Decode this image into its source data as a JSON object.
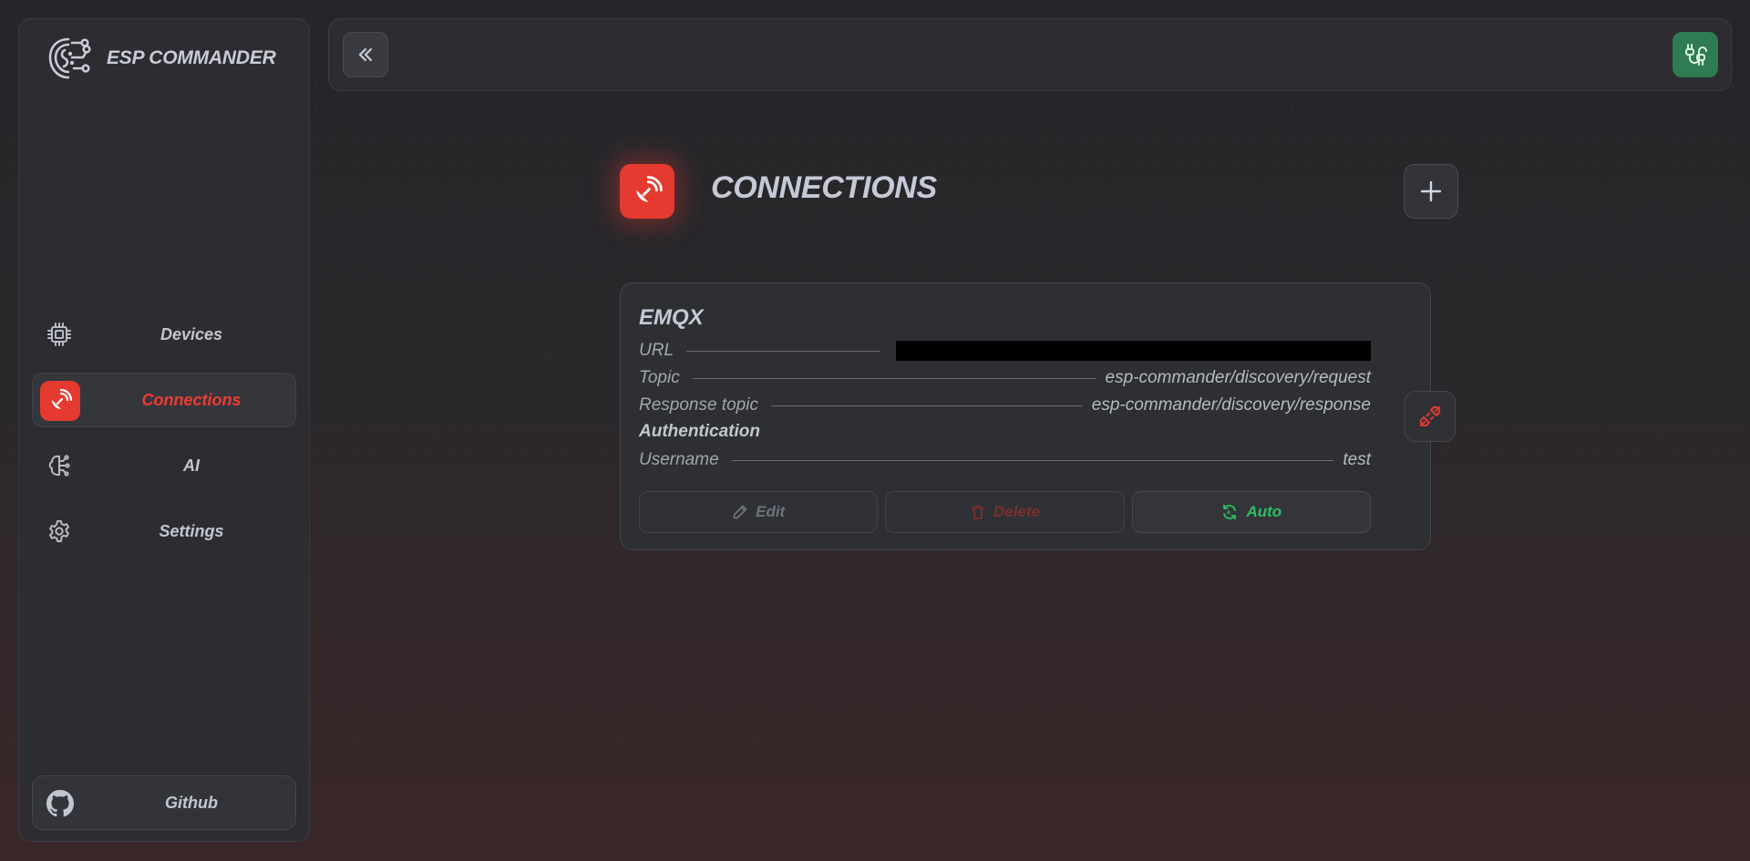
{
  "brand": {
    "name": "ESP COMMANDER",
    "logo_icon": "circuit-brain-logo"
  },
  "sidebar": {
    "items": [
      {
        "label": "Devices",
        "icon": "chip-icon",
        "active": false
      },
      {
        "label": "Connections",
        "icon": "satellite-dish-icon",
        "active": true
      },
      {
        "label": "AI",
        "icon": "brain-circuit-icon",
        "active": false
      },
      {
        "label": "Settings",
        "icon": "gear-icon",
        "active": false
      }
    ],
    "github_label": "Github"
  },
  "topbar": {
    "collapse_icon": "chevrons-left-icon",
    "status_icon": "plug-icon"
  },
  "page": {
    "title": "CONNECTIONS",
    "add_icon": "plus-icon"
  },
  "connection": {
    "name": "EMQX",
    "url_label": "URL",
    "url_value": "",
    "topic_label": "Topic",
    "topic_value": "esp-commander/discovery/request",
    "response_topic_label": "Response topic",
    "response_topic_value": "esp-commander/discovery/response",
    "auth_title": "Authentication",
    "username_label": "Username",
    "username_value": "test",
    "edit_label": "Edit",
    "delete_label": "Delete",
    "auto_label": "Auto"
  },
  "colors": {
    "accent_red": "#e53a2f",
    "success_green": "#2fbf5f",
    "plug_button_green": "#2f7b52"
  }
}
